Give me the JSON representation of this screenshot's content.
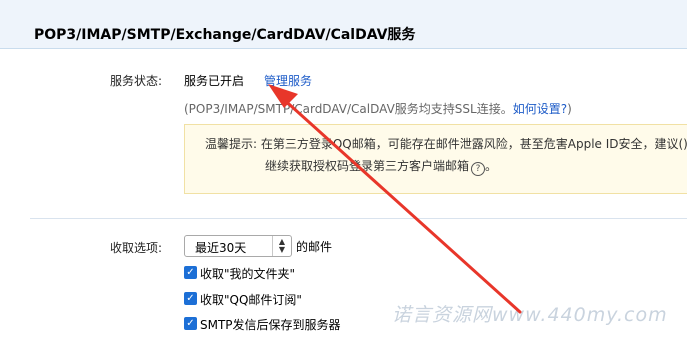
{
  "header": {
    "title": "POP3/IMAP/SMTP/Exchange/CardDAV/CalDAV服务"
  },
  "service_status": {
    "label": "服务状态:",
    "value": "服务已开启",
    "manage_link": "管理服务"
  },
  "ssl_note": {
    "text": "(POP3/IMAP/SMTP/CardDAV/CalDAV服务均支持SSL连接。",
    "link": "如何设置?",
    "suffix": ")"
  },
  "warning": {
    "line1": "温馨提示:  在第三方登录QQ邮箱，可能存在邮件泄露风险，甚至危害Apple ID安全，建议()",
    "line2": "继续获取授权码登录第三方客户端邮箱",
    "help_icon": "?"
  },
  "receive_options": {
    "label": "收取选项:",
    "period_select": "最近30天",
    "period_suffix": "的邮件",
    "checkboxes": [
      {
        "label": "收取\"我的文件夹\"",
        "checked": true
      },
      {
        "label": "收取\"QQ邮件订阅\"",
        "checked": true
      },
      {
        "label": "SMTP发信后保存到服务器",
        "checked": true
      }
    ]
  },
  "watermark": "诺言资源网www.440my.com",
  "colors": {
    "link": "#1e5cc8",
    "arrow": "#e8362a",
    "checkbox": "#1c6fd6"
  }
}
